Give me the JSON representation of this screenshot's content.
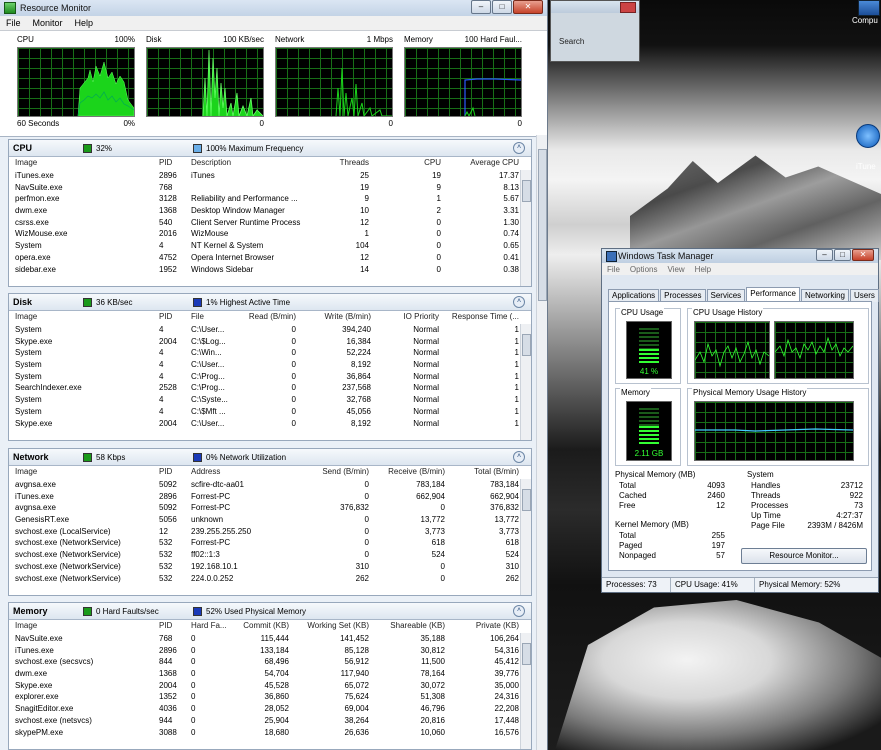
{
  "desktop": {
    "icon1_label": "Compu",
    "icon2_label": "iTune",
    "bgwin_search": "Search"
  },
  "rm": {
    "title": "Resource Monitor",
    "menu": [
      "File",
      "Monitor",
      "Help"
    ],
    "graphs": [
      {
        "name": "CPU",
        "scale": "100%",
        "foot_left": "60 Seconds",
        "foot_right": "0%"
      },
      {
        "name": "Disk",
        "scale": "100 KB/sec",
        "foot_left": "",
        "foot_right": "0"
      },
      {
        "name": "Network",
        "scale": "1 Mbps",
        "foot_left": "",
        "foot_right": "0"
      },
      {
        "name": "Memory",
        "scale": "100 Hard Faul...",
        "foot_left": "",
        "foot_right": "0"
      }
    ],
    "cpu": {
      "title": "CPU",
      "badge1": "32%",
      "badge1_color": "#1a9a1a",
      "badge2": "100% Maximum Frequency",
      "badge2_color": "#6aaee8",
      "cols": [
        "Image",
        "PID",
        "Description",
        "Threads",
        "CPU",
        "Average CPU"
      ],
      "rows": [
        [
          "iTunes.exe",
          "2896",
          "iTunes",
          "25",
          "19",
          "17.37"
        ],
        [
          "NavSuite.exe",
          "768",
          "",
          "19",
          "9",
          "8.13"
        ],
        [
          "perfmon.exe",
          "3128",
          "Reliability and Performance ...",
          "9",
          "1",
          "5.67"
        ],
        [
          "dwm.exe",
          "1368",
          "Desktop Window Manager",
          "10",
          "2",
          "3.31"
        ],
        [
          "csrss.exe",
          "540",
          "Client Server Runtime Process",
          "12",
          "0",
          "1.30"
        ],
        [
          "WizMouse.exe",
          "2016",
          "WizMouse",
          "1",
          "0",
          "0.74"
        ],
        [
          "System",
          "4",
          "NT Kernel & System",
          "104",
          "0",
          "0.65"
        ],
        [
          "opera.exe",
          "4752",
          "Opera Internet Browser",
          "12",
          "0",
          "0.41"
        ],
        [
          "sidebar.exe",
          "1952",
          "Windows Sidebar",
          "14",
          "0",
          "0.38"
        ]
      ]
    },
    "disk": {
      "title": "Disk",
      "badge1": "36 KB/sec",
      "badge1_color": "#1a9a1a",
      "badge2": "1% Highest Active Time",
      "badge2_color": "#1a3ab8",
      "cols": [
        "Image",
        "PID",
        "File",
        "Read (B/min)",
        "Write (B/min)",
        "IO Priority",
        "Response Time (..."
      ],
      "rows": [
        [
          "System",
          "4",
          "C:\\User...",
          "0",
          "394,240",
          "Normal",
          "1"
        ],
        [
          "Skype.exe",
          "2004",
          "C:\\$Log...",
          "0",
          "16,384",
          "Normal",
          "1"
        ],
        [
          "System",
          "4",
          "C:\\Win...",
          "0",
          "52,224",
          "Normal",
          "1"
        ],
        [
          "System",
          "4",
          "C:\\User...",
          "0",
          "8,192",
          "Normal",
          "1"
        ],
        [
          "System",
          "4",
          "C:\\Prog...",
          "0",
          "36,864",
          "Normal",
          "1"
        ],
        [
          "SearchIndexer.exe",
          "2528",
          "C:\\Prog...",
          "0",
          "237,568",
          "Normal",
          "1"
        ],
        [
          "System",
          "4",
          "C:\\Syste...",
          "0",
          "32,768",
          "Normal",
          "1"
        ],
        [
          "System",
          "4",
          "C:\\$Mft ...",
          "0",
          "45,056",
          "Normal",
          "1"
        ],
        [
          "Skype.exe",
          "2004",
          "C:\\User...",
          "0",
          "8,192",
          "Normal",
          "1"
        ]
      ]
    },
    "network": {
      "title": "Network",
      "badge1": "58 Kbps",
      "badge1_color": "#1a9a1a",
      "badge2": "0% Network Utilization",
      "badge2_color": "#1a3ab8",
      "cols": [
        "Image",
        "PID",
        "Address",
        "Send (B/min)",
        "Receive (B/min)",
        "Total (B/min)"
      ],
      "rows": [
        [
          "avgnsa.exe",
          "5092",
          "scfire-dtc-aa01",
          "0",
          "783,184",
          "783,184"
        ],
        [
          "iTunes.exe",
          "2896",
          "Forrest-PC",
          "0",
          "662,904",
          "662,904"
        ],
        [
          "avgnsa.exe",
          "5092",
          "Forrest-PC",
          "376,832",
          "0",
          "376,832"
        ],
        [
          "GenesisRT.exe",
          "5056",
          "unknown",
          "0",
          "13,772",
          "13,772"
        ],
        [
          "svchost.exe (LocalService)",
          "12",
          "239.255.255.250",
          "0",
          "3,773",
          "3,773"
        ],
        [
          "svchost.exe (NetworkService)",
          "532",
          "Forrest-PC",
          "0",
          "618",
          "618"
        ],
        [
          "svchost.exe (NetworkService)",
          "532",
          "ff02::1:3",
          "0",
          "524",
          "524"
        ],
        [
          "svchost.exe (NetworkService)",
          "532",
          "192.168.10.1",
          "310",
          "0",
          "310"
        ],
        [
          "svchost.exe (NetworkService)",
          "532",
          "224.0.0.252",
          "262",
          "0",
          "262"
        ]
      ]
    },
    "memory": {
      "title": "Memory",
      "badge1": "0 Hard Faults/sec",
      "badge1_color": "#1a9a1a",
      "badge2": "52% Used Physical Memory",
      "badge2_color": "#1a3ab8",
      "cols": [
        "Image",
        "PID",
        "Hard Fa...",
        "Commit (KB)",
        "Working Set (KB)",
        "Shareable (KB)",
        "Private (KB)"
      ],
      "rows": [
        [
          "NavSuite.exe",
          "768",
          "0",
          "115,444",
          "141,452",
          "35,188",
          "106,264"
        ],
        [
          "iTunes.exe",
          "2896",
          "0",
          "133,184",
          "85,128",
          "30,812",
          "54,316"
        ],
        [
          "svchost.exe (secsvcs)",
          "844",
          "0",
          "68,496",
          "56,912",
          "11,500",
          "45,412"
        ],
        [
          "dwm.exe",
          "1368",
          "0",
          "54,704",
          "117,940",
          "78,164",
          "39,776"
        ],
        [
          "Skype.exe",
          "2004",
          "0",
          "45,528",
          "65,072",
          "30,072",
          "35,000"
        ],
        [
          "explorer.exe",
          "1352",
          "0",
          "36,860",
          "75,624",
          "51,308",
          "24,316"
        ],
        [
          "SnagitEditor.exe",
          "4036",
          "0",
          "28,052",
          "69,004",
          "46,796",
          "22,208"
        ],
        [
          "svchost.exe (netsvcs)",
          "944",
          "0",
          "25,904",
          "38,264",
          "20,816",
          "17,448"
        ],
        [
          "skypePM.exe",
          "3088",
          "0",
          "18,680",
          "26,636",
          "10,060",
          "16,576"
        ]
      ]
    }
  },
  "tm": {
    "title": "Windows Task Manager",
    "menu": [
      "File",
      "Options",
      "View",
      "Help"
    ],
    "tabs": [
      "Applications",
      "Processes",
      "Services",
      "Performance",
      "Networking",
      "Users"
    ],
    "selected_tab": "Performance",
    "cpu_usage_label": "CPU Usage",
    "cpu_usage_value": "41 %",
    "cpu_usage_fraction": 0.41,
    "cpu_history_label": "CPU Usage History",
    "memory_label": "Memory",
    "memory_value": "2.11 GB",
    "memory_fraction": 0.52,
    "phys_history_label": "Physical Memory Usage History",
    "physical_memory": {
      "title": "Physical Memory (MB)",
      "items": [
        [
          "Total",
          "4093"
        ],
        [
          "Cached",
          "2460"
        ],
        [
          "Free",
          "12"
        ]
      ]
    },
    "kernel_memory": {
      "title": "Kernel Memory (MB)",
      "items": [
        [
          "Total",
          "255"
        ],
        [
          "Paged",
          "197"
        ],
        [
          "Nonpaged",
          "57"
        ]
      ]
    },
    "system": {
      "title": "System",
      "items": [
        [
          "Handles",
          "23712"
        ],
        [
          "Threads",
          "922"
        ],
        [
          "Processes",
          "73"
        ],
        [
          "Up Time",
          "4:27:37"
        ],
        [
          "Page File",
          "2393M / 8426M"
        ]
      ]
    },
    "resource_monitor_button": "Resource Monitor...",
    "status": [
      "Processes: 73",
      "CPU Usage: 41%",
      "Physical Memory: 52%"
    ]
  }
}
